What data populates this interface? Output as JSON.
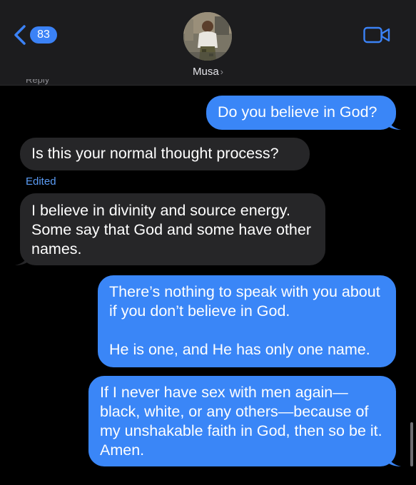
{
  "header": {
    "back_count": "83",
    "contact_name": "Musa",
    "contact_chevron": "›",
    "icons": {
      "back": "chevron-left-icon",
      "video": "video-camera-icon"
    }
  },
  "thread": {
    "clipped_label": "Reply",
    "edited_label": "Edited",
    "messages": [
      {
        "from": "me",
        "text": "Do you believe in God?"
      },
      {
        "from": "them",
        "text": "Is this your normal thought process?"
      },
      {
        "from": "them",
        "text": "I believe in divinity and source energy. Some say that God and some have other names."
      },
      {
        "from": "me",
        "paragraphs": [
          "There’s nothing to speak with you about if you don’t believe in God.",
          "He is one, and He has only one name."
        ]
      },
      {
        "from": "me",
        "text": "If I never have sex with men again—black, white, or any others—because of my unshakable faith in God, then so be it. Amen."
      }
    ]
  },
  "colors": {
    "sent_bubble": "#3a86f7",
    "received_bubble": "#262628",
    "accent": "#3b82f6",
    "header_bg": "#1c1c1e"
  }
}
